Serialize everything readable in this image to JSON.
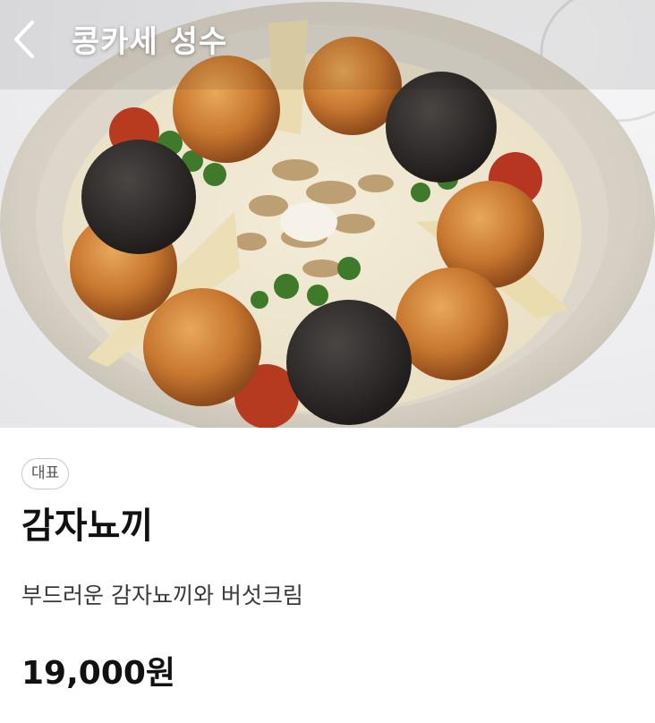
{
  "header": {
    "back_icon": "chevron-left-icon",
    "title": "콩카세 성수"
  },
  "hero": {
    "image_subject": "food-photo"
  },
  "menu_item": {
    "badge": "대표",
    "name": "감자뇨끼",
    "description": "부드러운 감자뇨끼와 버섯크림",
    "price": "19,000원"
  },
  "colors": {
    "background": "#ffffff",
    "title_text": "#ffffff",
    "badge_border": "#c9c9cc",
    "badge_text": "#555555",
    "body_text": "#111111"
  }
}
